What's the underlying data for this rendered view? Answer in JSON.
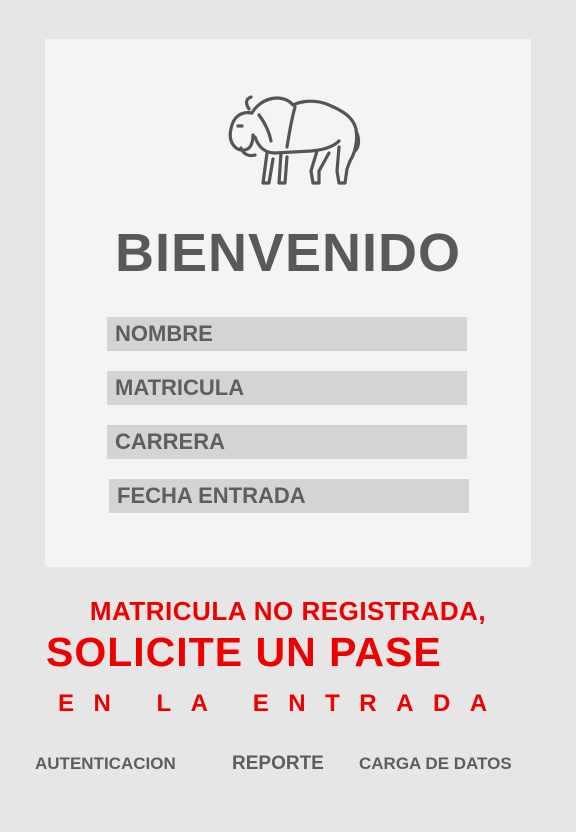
{
  "card": {
    "logo_icon": "bison-icon",
    "title": "BIENVENIDO",
    "fields": [
      {
        "label": "NOMBRE"
      },
      {
        "label": "MATRICULA"
      },
      {
        "label": "CARRERA"
      },
      {
        "label": "FECHA ENTRADA"
      }
    ]
  },
  "message": {
    "line1": "MATRICULA NO REGISTRADA,",
    "line2": "SOLICITE UN PASE",
    "line3": "EN LA ENTRADA",
    "color": "#ee0000"
  },
  "nav": {
    "autenticacion": "AUTENTICACION",
    "reporte": "REPORTE",
    "carga": "CARGA DE DATOS"
  }
}
